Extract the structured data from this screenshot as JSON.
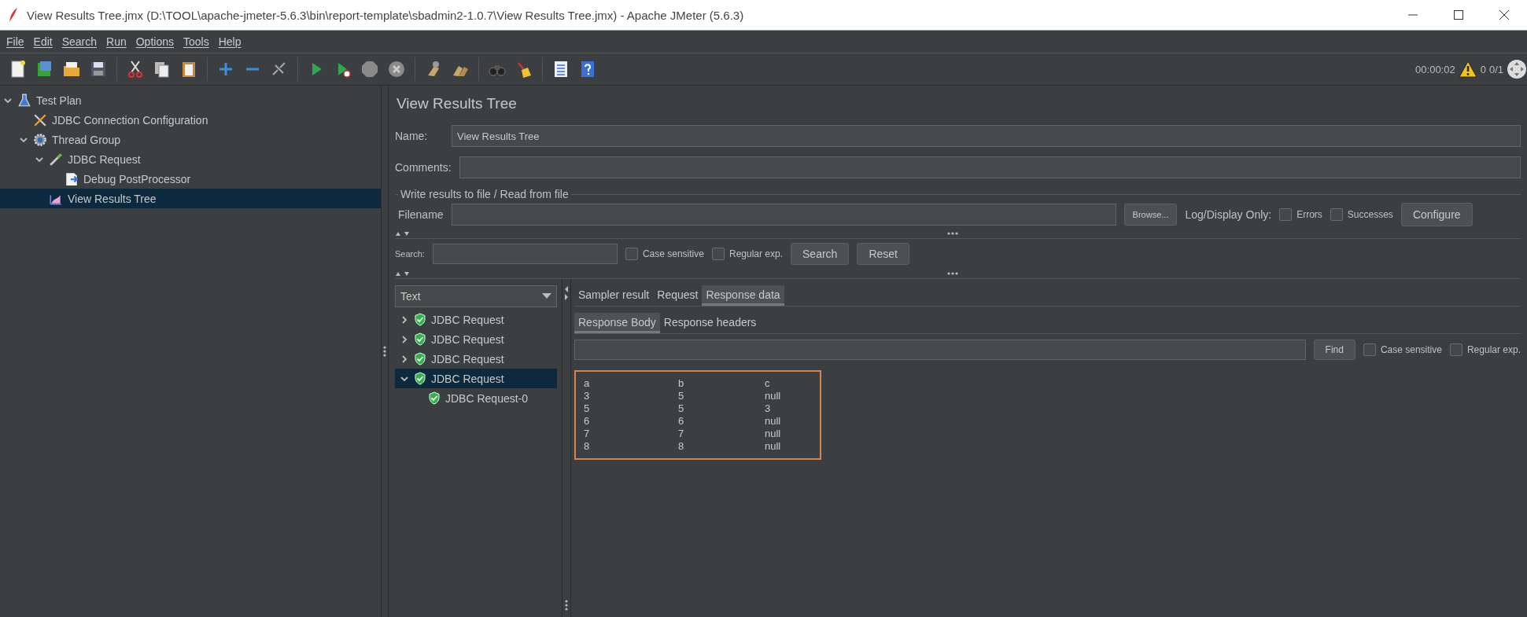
{
  "window": {
    "title": "View Results Tree.jmx (D:\\TOOL\\apache-jmeter-5.6.3\\bin\\report-template\\sbadmin2-1.0.7\\View Results Tree.jmx) - Apache JMeter (5.6.3)"
  },
  "menu": [
    "File",
    "Edit",
    "Search",
    "Run",
    "Options",
    "Tools",
    "Help"
  ],
  "status": {
    "elapsed": "00:00:02",
    "warnings": "0",
    "threads": "0/1"
  },
  "tree": [
    {
      "label": "Test Plan",
      "kind": "plan",
      "expanded": true,
      "selected": false,
      "children": [
        {
          "label": "JDBC Connection Configuration",
          "kind": "config",
          "selected": false
        },
        {
          "label": "Thread Group",
          "kind": "threads",
          "expanded": true,
          "selected": false,
          "children": [
            {
              "label": "JDBC Request",
              "kind": "sampler",
              "expanded": true,
              "selected": false,
              "children": [
                {
                  "label": "Debug PostProcessor",
                  "kind": "post",
                  "selected": false
                }
              ]
            },
            {
              "label": "View Results Tree",
              "kind": "listener",
              "selected": true
            }
          ]
        }
      ]
    }
  ],
  "panel": {
    "title": "View Results Tree",
    "name_label": "Name:",
    "name_value": "View Results Tree",
    "comments_label": "Comments:",
    "file_group": "Write results to file / Read from file",
    "filename_label": "Filename",
    "browse": "Browse...",
    "log_label": "Log/Display Only:",
    "log_options": [
      {
        "label": "Errors",
        "checked": false
      },
      {
        "label": "Successes",
        "checked": false
      }
    ],
    "configure": "Configure"
  },
  "search": {
    "label": "Search:",
    "options": [
      {
        "label": "Case sensitive",
        "checked": false
      },
      {
        "label": "Regular exp.",
        "checked": false
      }
    ],
    "buttons": [
      "Search",
      "Reset"
    ]
  },
  "results": {
    "renderer": "Text",
    "samples": [
      {
        "label": "JDBC Request",
        "expanded": false,
        "selected": false
      },
      {
        "label": "JDBC Request",
        "expanded": false,
        "selected": false
      },
      {
        "label": "JDBC Request",
        "expanded": false,
        "selected": false
      },
      {
        "label": "JDBC Request",
        "expanded": true,
        "selected": true,
        "children": [
          {
            "label": "JDBC Request-0",
            "selected": false
          }
        ]
      }
    ]
  },
  "tabs": [
    {
      "label": "Sampler result",
      "selected": false
    },
    {
      "label": "Request",
      "selected": false
    },
    {
      "label": "Response data",
      "selected": true
    }
  ],
  "subtabs": [
    {
      "label": "Response Body",
      "selected": true
    },
    {
      "label": "Response headers",
      "selected": false
    }
  ],
  "find": {
    "button": "Find",
    "options": [
      {
        "label": "Case sensitive",
        "checked": false
      },
      {
        "label": "Regular exp.",
        "checked": false
      }
    ]
  },
  "response_body": {
    "highlighted": true,
    "rows": [
      [
        "a",
        "b",
        "c"
      ],
      [
        "3",
        "5",
        "null"
      ],
      [
        "5",
        "5",
        "3"
      ],
      [
        "6",
        "6",
        "null"
      ],
      [
        "7",
        "7",
        "null"
      ],
      [
        "8",
        "8",
        "null"
      ]
    ]
  }
}
